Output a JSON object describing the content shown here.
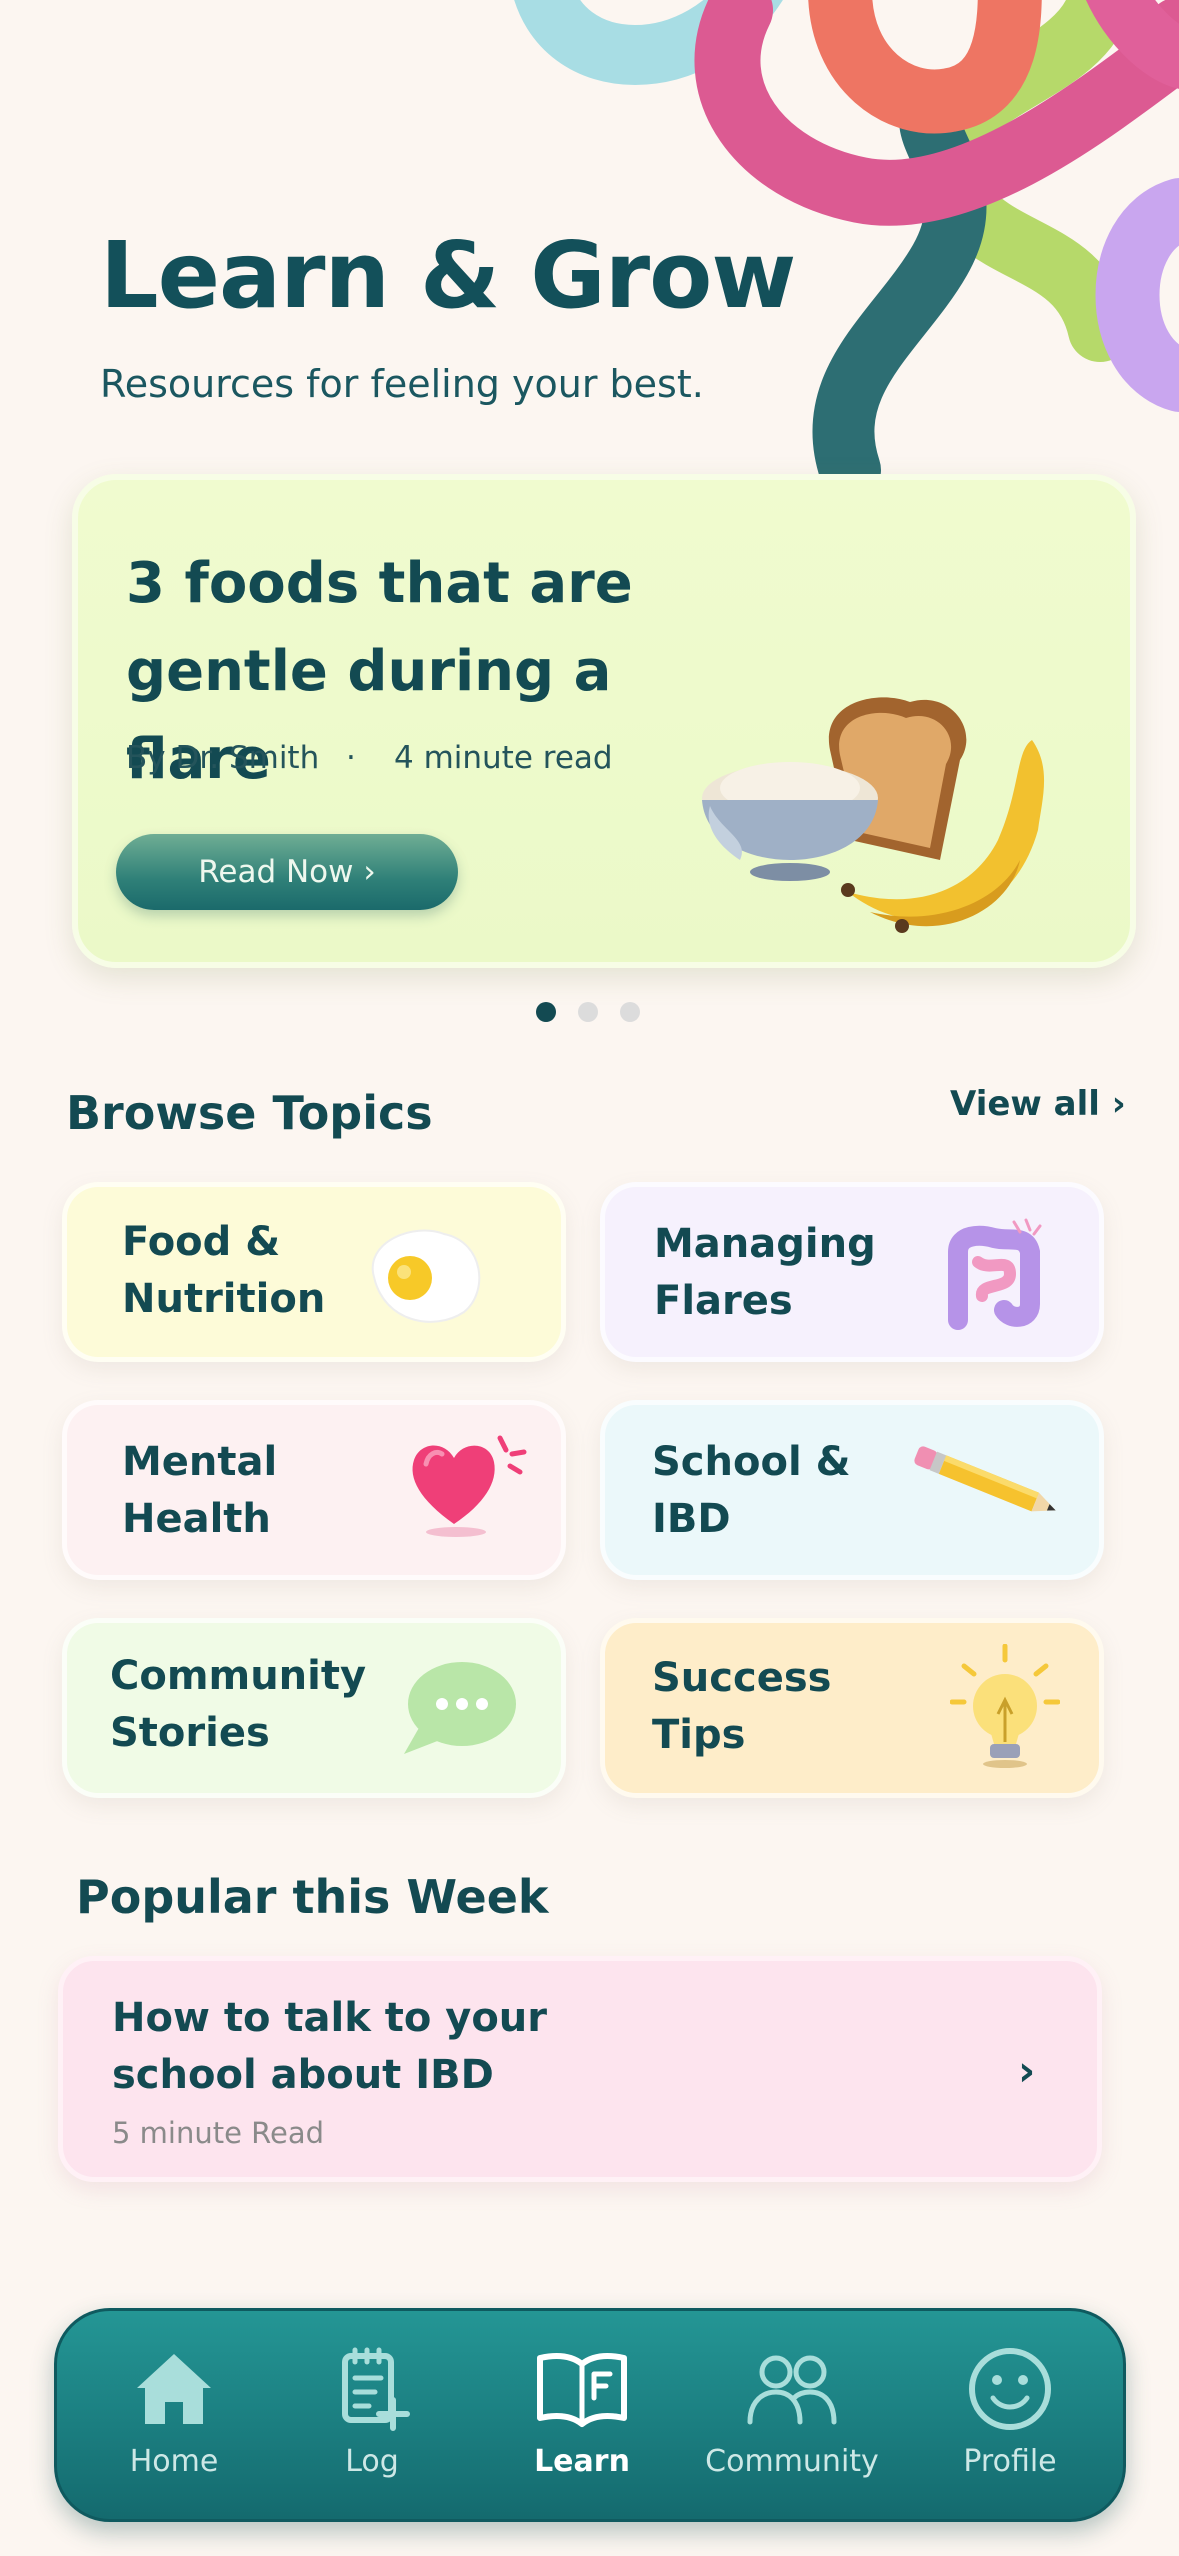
{
  "hero": {
    "title": "Learn & Grow",
    "subtitle": "Resources for feeling your best."
  },
  "featured": {
    "title": "3 foods that are gentle during a flare",
    "author": "By Dr. Smith",
    "separator": "·",
    "read_time": "4 minute read",
    "button_label": "Read Now ›",
    "carousel_pages": 3,
    "carousel_active": 1
  },
  "topics": {
    "title": "Browse Topics",
    "view_all": "View all ›",
    "items": [
      {
        "label": "Food & Nutrition",
        "icon": "fried-egg-icon",
        "bg": "#fdfbd8"
      },
      {
        "label": "Managing Flares",
        "icon": "intestine-icon",
        "bg": "#f6f1fd"
      },
      {
        "label": "Mental Health",
        "icon": "heart-icon",
        "bg": "#fdf1f2"
      },
      {
        "label": "School & IBD",
        "icon": "pencil-icon",
        "bg": "#ebf8fa"
      },
      {
        "label": "Community Stories",
        "icon": "chat-bubble-icon",
        "bg": "#f0fbe6"
      },
      {
        "label": "Success Tips",
        "icon": "lightbulb-icon",
        "bg": "#feedc9"
      }
    ]
  },
  "popular": {
    "title": "Popular this Week",
    "item_title": "How to talk to your school about IBD",
    "item_subtitle": "5 minute Read",
    "chevron": "›"
  },
  "nav": {
    "items": [
      {
        "label": "Home",
        "icon": "home-icon"
      },
      {
        "label": "Log",
        "icon": "log-icon"
      },
      {
        "label": "Learn",
        "icon": "book-icon",
        "active": true
      },
      {
        "label": "Community",
        "icon": "people-icon"
      },
      {
        "label": "Profile",
        "icon": "smiley-icon"
      }
    ]
  },
  "colors": {
    "primary": "#134a52",
    "accent_teal": "#1b7e80",
    "background": "#fcf6f1",
    "feature_bg": "#ebf9c8"
  }
}
